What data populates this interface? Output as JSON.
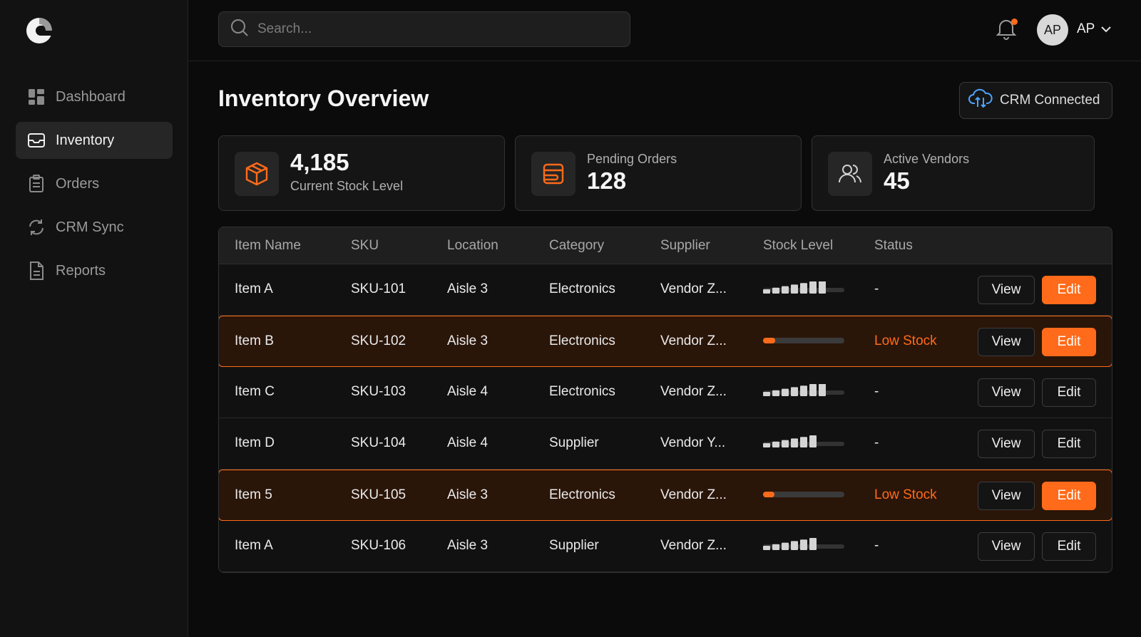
{
  "sidebar": {
    "items": [
      {
        "label": "Dashboard",
        "icon": "dashboard-icon",
        "active": false
      },
      {
        "label": "Inventory",
        "icon": "inbox-icon",
        "active": true
      },
      {
        "label": "Orders",
        "icon": "clipboard-icon",
        "active": false
      },
      {
        "label": "CRM Sync",
        "icon": "sync-icon",
        "active": false
      },
      {
        "label": "Reports",
        "icon": "document-icon",
        "active": false
      }
    ]
  },
  "topbar": {
    "search_placeholder": "Search...",
    "avatar_initials": "AP",
    "user_name": "AP"
  },
  "main": {
    "title": "Inventory Overview",
    "crm_badge": "CRM Connected"
  },
  "stats": [
    {
      "value": "4,185",
      "label": "Current Stock Level",
      "icon": "box-icon"
    },
    {
      "value": "128",
      "label": "Pending Orders",
      "icon": "orders-icon"
    },
    {
      "value": "45",
      "label": "Active Vendors",
      "icon": "users-icon"
    }
  ],
  "table": {
    "headers": [
      "Item Name",
      "SKU",
      "Location",
      "Category",
      "Supplier",
      "Stock Level",
      "Status"
    ],
    "view_label": "View",
    "edit_label": "Edit",
    "rows": [
      {
        "name": "Item A",
        "sku": "SKU-101",
        "location": "Aisle 3",
        "category": "Electronics",
        "supplier": "Vendor Z...",
        "stock_level": 0.8,
        "status": "-",
        "low": false
      },
      {
        "name": "Item B",
        "sku": "SKU-102",
        "location": "Aisle 3",
        "category": "Electronics",
        "supplier": "Vendor Z...",
        "stock_level": 0.15,
        "status": "Low Stock",
        "low": true
      },
      {
        "name": "Item C",
        "sku": "SKU-103",
        "location": "Aisle 4",
        "category": "Electronics",
        "supplier": "Vendor Z...",
        "stock_level": 0.8,
        "status": "-",
        "low": false
      },
      {
        "name": "Item D",
        "sku": "SKU-104",
        "location": "Aisle 4",
        "category": "Supplier",
        "supplier": "Vendor Y...",
        "stock_level": 0.65,
        "status": "-",
        "low": false
      },
      {
        "name": "Item 5",
        "sku": "SKU-105",
        "location": "Aisle 3",
        "category": "Electronics",
        "supplier": "Vendor Z...",
        "stock_level": 0.14,
        "status": "Low Stock",
        "low": true
      },
      {
        "name": "Item A",
        "sku": "SKU-106",
        "location": "Aisle 3",
        "category": "Supplier",
        "supplier": "Vendor Z...",
        "stock_level": 0.65,
        "status": "-",
        "low": false
      }
    ]
  },
  "colors": {
    "accent": "#ff6b1a",
    "background": "#0b0b0b",
    "surface": "#151515"
  }
}
